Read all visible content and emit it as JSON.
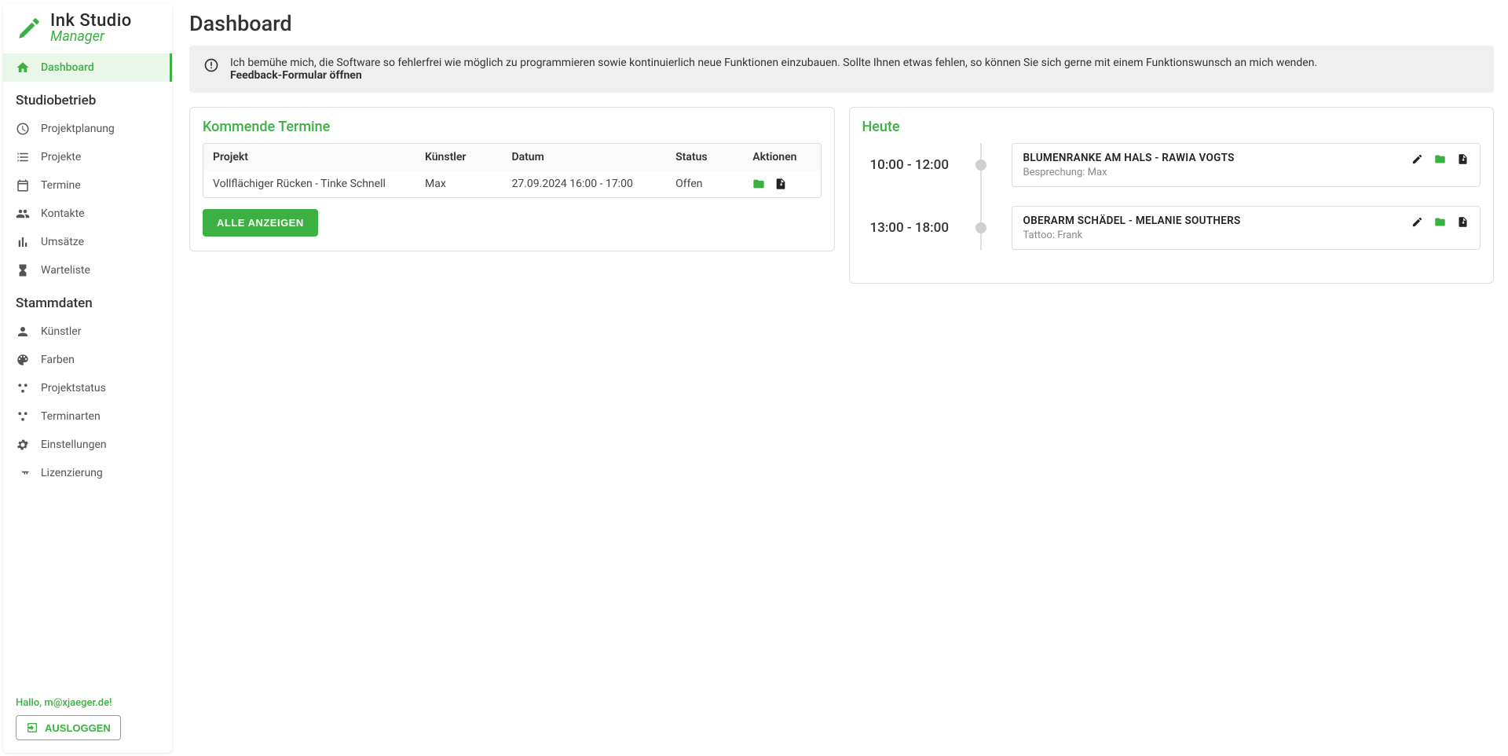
{
  "logo": {
    "line1": "Ink Studio",
    "line2": "Manager"
  },
  "page_title": "Dashboard",
  "info": {
    "text": "Ich bemühe mich, die Software so fehlerfrei wie möglich zu programmieren sowie kontinuierlich neue Funktionen einzubauen. Sollte Ihnen etwas fehlen, so können Sie sich gerne mit einem Funktionswunsch an mich wenden.",
    "link": "Feedback-Formular öffnen"
  },
  "sidebar": {
    "sections": {
      "studiobetrieb": "Studiobetrieb",
      "stammdaten": "Stammdaten"
    },
    "items": {
      "dashboard": "Dashboard",
      "projektplanung": "Projektplanung",
      "projekte": "Projekte",
      "termine": "Termine",
      "kontakte": "Kontakte",
      "umsaetze": "Umsätze",
      "warteliste": "Warteliste",
      "kuenstler": "Künstler",
      "farben": "Farben",
      "projektstatus": "Projektstatus",
      "terminarten": "Terminarten",
      "einstellungen": "Einstellungen",
      "lizenzierung": "Lizenzierung"
    },
    "greeting": "Hallo, m@xjaeger.de!",
    "logout": "AUSLOGGEN"
  },
  "upcoming": {
    "title": "Kommende Termine",
    "columns": {
      "projekt": "Projekt",
      "kuenstler": "Künstler",
      "datum": "Datum",
      "status": "Status",
      "aktionen": "Aktionen"
    },
    "rows": [
      {
        "projekt": "Vollflächiger Rücken - Tinke Schnell",
        "kuenstler": "Max",
        "datum": "27.09.2024 16:00 - 17:00",
        "status": "Offen"
      }
    ],
    "show_all": "ALLE ANZEIGEN"
  },
  "today": {
    "title": "Heute",
    "events": [
      {
        "time": "10:00 - 12:00",
        "title": "BLUMENRANKE AM HALS - RAWIA VOGTS",
        "sub": "Besprechung: Max"
      },
      {
        "time": "13:00 - 18:00",
        "title": "OBERARM SCHÄDEL - MELANIE SOUTHERS",
        "sub": "Tattoo: Frank"
      }
    ]
  }
}
